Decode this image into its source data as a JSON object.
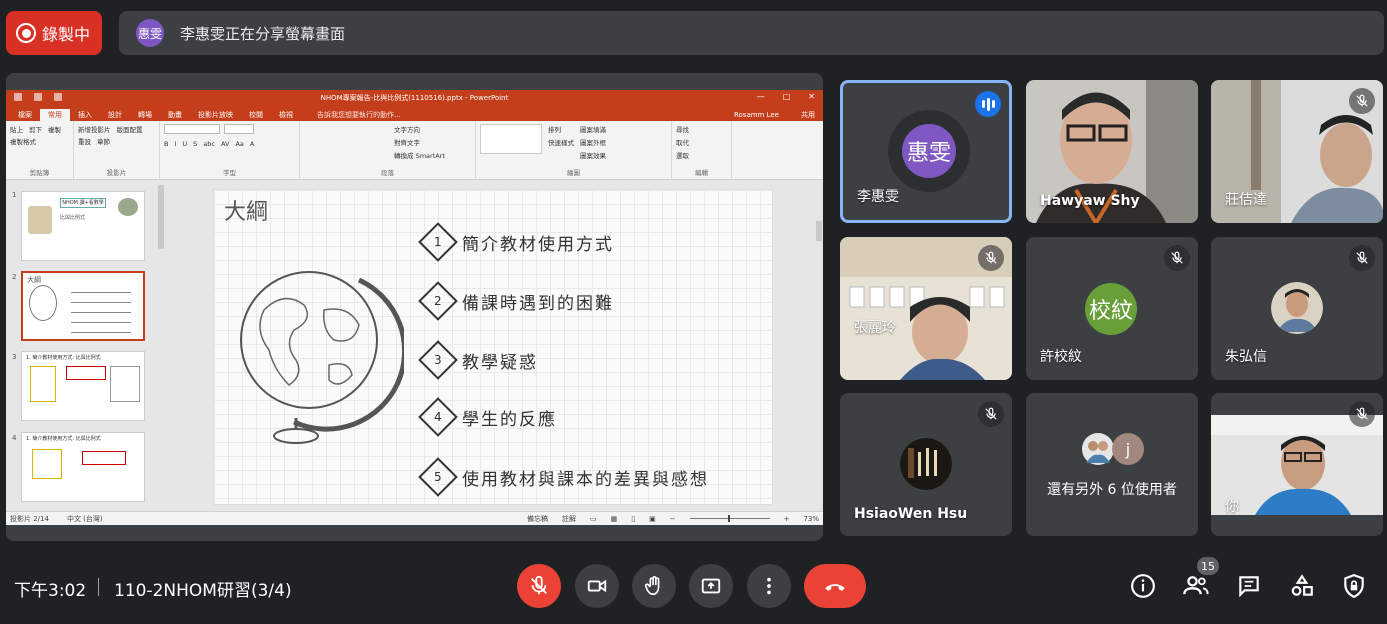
{
  "recording": {
    "label": "錄製中"
  },
  "share_banner": {
    "avatar_text": "惠雯",
    "text": "李惠雯正在分享螢幕畫面"
  },
  "powerpoint": {
    "window_title": "NHOM專案報告-比與比例式(1110516).pptx - PowerPoint",
    "tabs": [
      "檔案",
      "常用",
      "插入",
      "設計",
      "轉場",
      "動畫",
      "投影片放映",
      "校閱",
      "檢視"
    ],
    "active_tab": "常用",
    "search_placeholder": "告訴我您想要執行的動作...",
    "user": "Rosamm Lee",
    "share": "共用",
    "ribbon_groups": [
      {
        "name": "剪貼簿",
        "items": [
          "貼上",
          "剪下",
          "複製",
          "複製格式"
        ]
      },
      {
        "name": "投影片",
        "items": [
          "新增投影片",
          "版面配置",
          "重設",
          "章節"
        ]
      },
      {
        "name": "字型",
        "items": [
          "B",
          "I",
          "U",
          "S",
          "abc",
          "AV",
          "Aa",
          "A"
        ]
      },
      {
        "name": "段落",
        "items": [
          "文字方向",
          "對齊文字",
          "轉換成 SmartArt"
        ]
      },
      {
        "name": "繪圖",
        "items": [
          "排列",
          "快速樣式",
          "圖案填滿",
          "圖案外框",
          "圖案效果"
        ]
      },
      {
        "name": "編輯",
        "items": [
          "尋找",
          "取代",
          "選取"
        ]
      }
    ],
    "thumbnails": [
      {
        "num": "1",
        "title": "NHOM 讀+看數學",
        "sub": "比與比例式"
      },
      {
        "num": "2",
        "title": "大綱",
        "sub": ""
      },
      {
        "num": "3",
        "title": "1. 簡介教材使用方式: 比與比例式",
        "sub": ""
      },
      {
        "num": "4",
        "title": "1. 簡介教材使用方式: 比與比例式",
        "sub": ""
      }
    ],
    "slide": {
      "title": "大綱",
      "items": [
        {
          "num": "1",
          "text": "簡介教材使用方式"
        },
        {
          "num": "2",
          "text": "備課時遇到的困難"
        },
        {
          "num": "3",
          "text": "教學疑惑"
        },
        {
          "num": "4",
          "text": "學生的反應"
        },
        {
          "num": "5",
          "text": "使用教材與課本的差異與感想"
        }
      ]
    },
    "status": {
      "slide_info": "投影片 2/14",
      "language": "中文 (台灣)",
      "notes": "備忘稿",
      "comments": "註解",
      "zoom": "73%"
    }
  },
  "participants": [
    {
      "name": "李惠雯",
      "avatar_text": "惠雯",
      "avatar_color": "#7e57c2",
      "speaking": true,
      "muted": false,
      "video": false
    },
    {
      "name": "Hawyaw Shy",
      "speaking": false,
      "muted": false,
      "video": true
    },
    {
      "name": "莊佶達",
      "speaking": false,
      "muted": true,
      "video": true
    },
    {
      "name": "張麗玲",
      "speaking": false,
      "muted": true,
      "video": true
    },
    {
      "name": "許校紋",
      "avatar_text": "校紋",
      "avatar_color": "#689f38",
      "speaking": false,
      "muted": true,
      "video": false
    },
    {
      "name": "朱弘信",
      "speaking": false,
      "muted": true,
      "video": false
    },
    {
      "name": "HsiaoWen Hsu",
      "speaking": false,
      "muted": true,
      "video": false
    },
    {
      "name": "還有另外 6 位使用者",
      "extra_avatar_text": "j",
      "speaking": false,
      "muted": false,
      "video": false
    },
    {
      "name": "你",
      "speaking": false,
      "muted": true,
      "video": true
    }
  ],
  "bottom_bar": {
    "time": "下午3:02",
    "meeting_name": "110-2NHOM研習(3/4)",
    "participant_count": "15"
  },
  "icons": [
    "record-icon",
    "mic-off-icon",
    "camera-icon",
    "raise-hand-icon",
    "present-icon",
    "more-options-icon",
    "hangup-icon",
    "info-icon",
    "people-icon",
    "chat-icon",
    "activities-icon",
    "host-controls-icon"
  ]
}
